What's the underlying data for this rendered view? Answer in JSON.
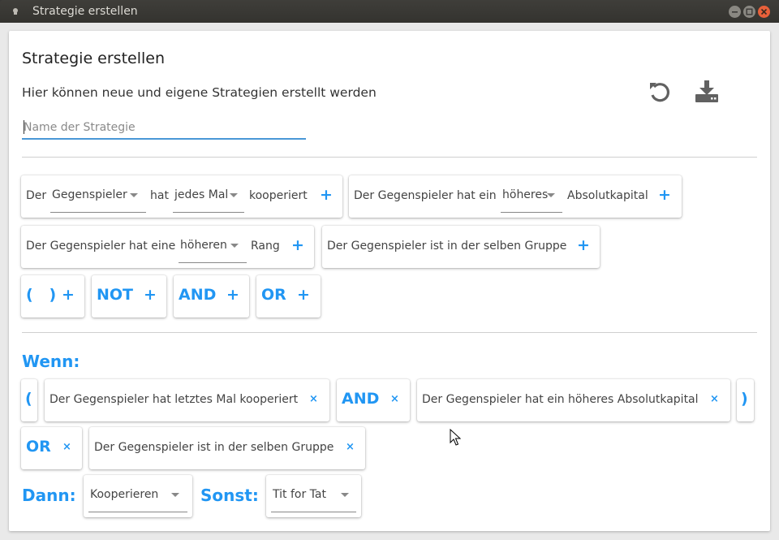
{
  "window": {
    "title": "Strategie erstellen"
  },
  "header": {
    "title": "Strategie erstellen",
    "subtitle": "Hier können neue und eigene Strategien erstellt werden",
    "name_placeholder": "Name der Strategie",
    "name_value": ""
  },
  "toolbar": {
    "reset_icon": "undo-icon",
    "save_icon": "download-icon"
  },
  "palette": {
    "row1": {
      "c1": {
        "prefix": "Der",
        "subject": "Gegenspieler",
        "mid": "hat",
        "frequency": "jedes Mal",
        "suffix": "kooperiert",
        "add": "+"
      },
      "c2": {
        "prefix": "Der Gegenspieler hat ein",
        "comparison": "höheres",
        "suffix": "Absolutkapital",
        "add": "+"
      }
    },
    "row2": {
      "c1": {
        "prefix": "Der Gegenspieler hat eine",
        "comparison": "höheren",
        "suffix": "Rang",
        "add": "+"
      },
      "c2": {
        "text": "Der Gegenspieler ist in der selben Gruppe",
        "add": "+"
      }
    },
    "operators": [
      {
        "label": "(   )",
        "add": "+"
      },
      {
        "label": "NOT",
        "add": "+"
      },
      {
        "label": "AND",
        "add": "+"
      },
      {
        "label": "OR",
        "add": "+"
      }
    ]
  },
  "rule": {
    "if_label": "Wenn:",
    "then_label": "Dann:",
    "else_label": "Sonst:",
    "open_paren": "(",
    "close_paren": ")",
    "cond1": "Der Gegenspieler hat letztes Mal kooperiert",
    "op1": "AND",
    "cond2": "Der Gegenspieler hat ein höheres Absolutkapital",
    "op2": "OR",
    "cond3": "Der Gegenspieler ist in der selben Gruppe",
    "remove": "×",
    "then_value": "Kooperieren",
    "else_value": "Tit for Tat"
  },
  "colors": {
    "accent": "#2196f3",
    "close_button": "#e8603a",
    "titlebar": "#3a3937"
  }
}
